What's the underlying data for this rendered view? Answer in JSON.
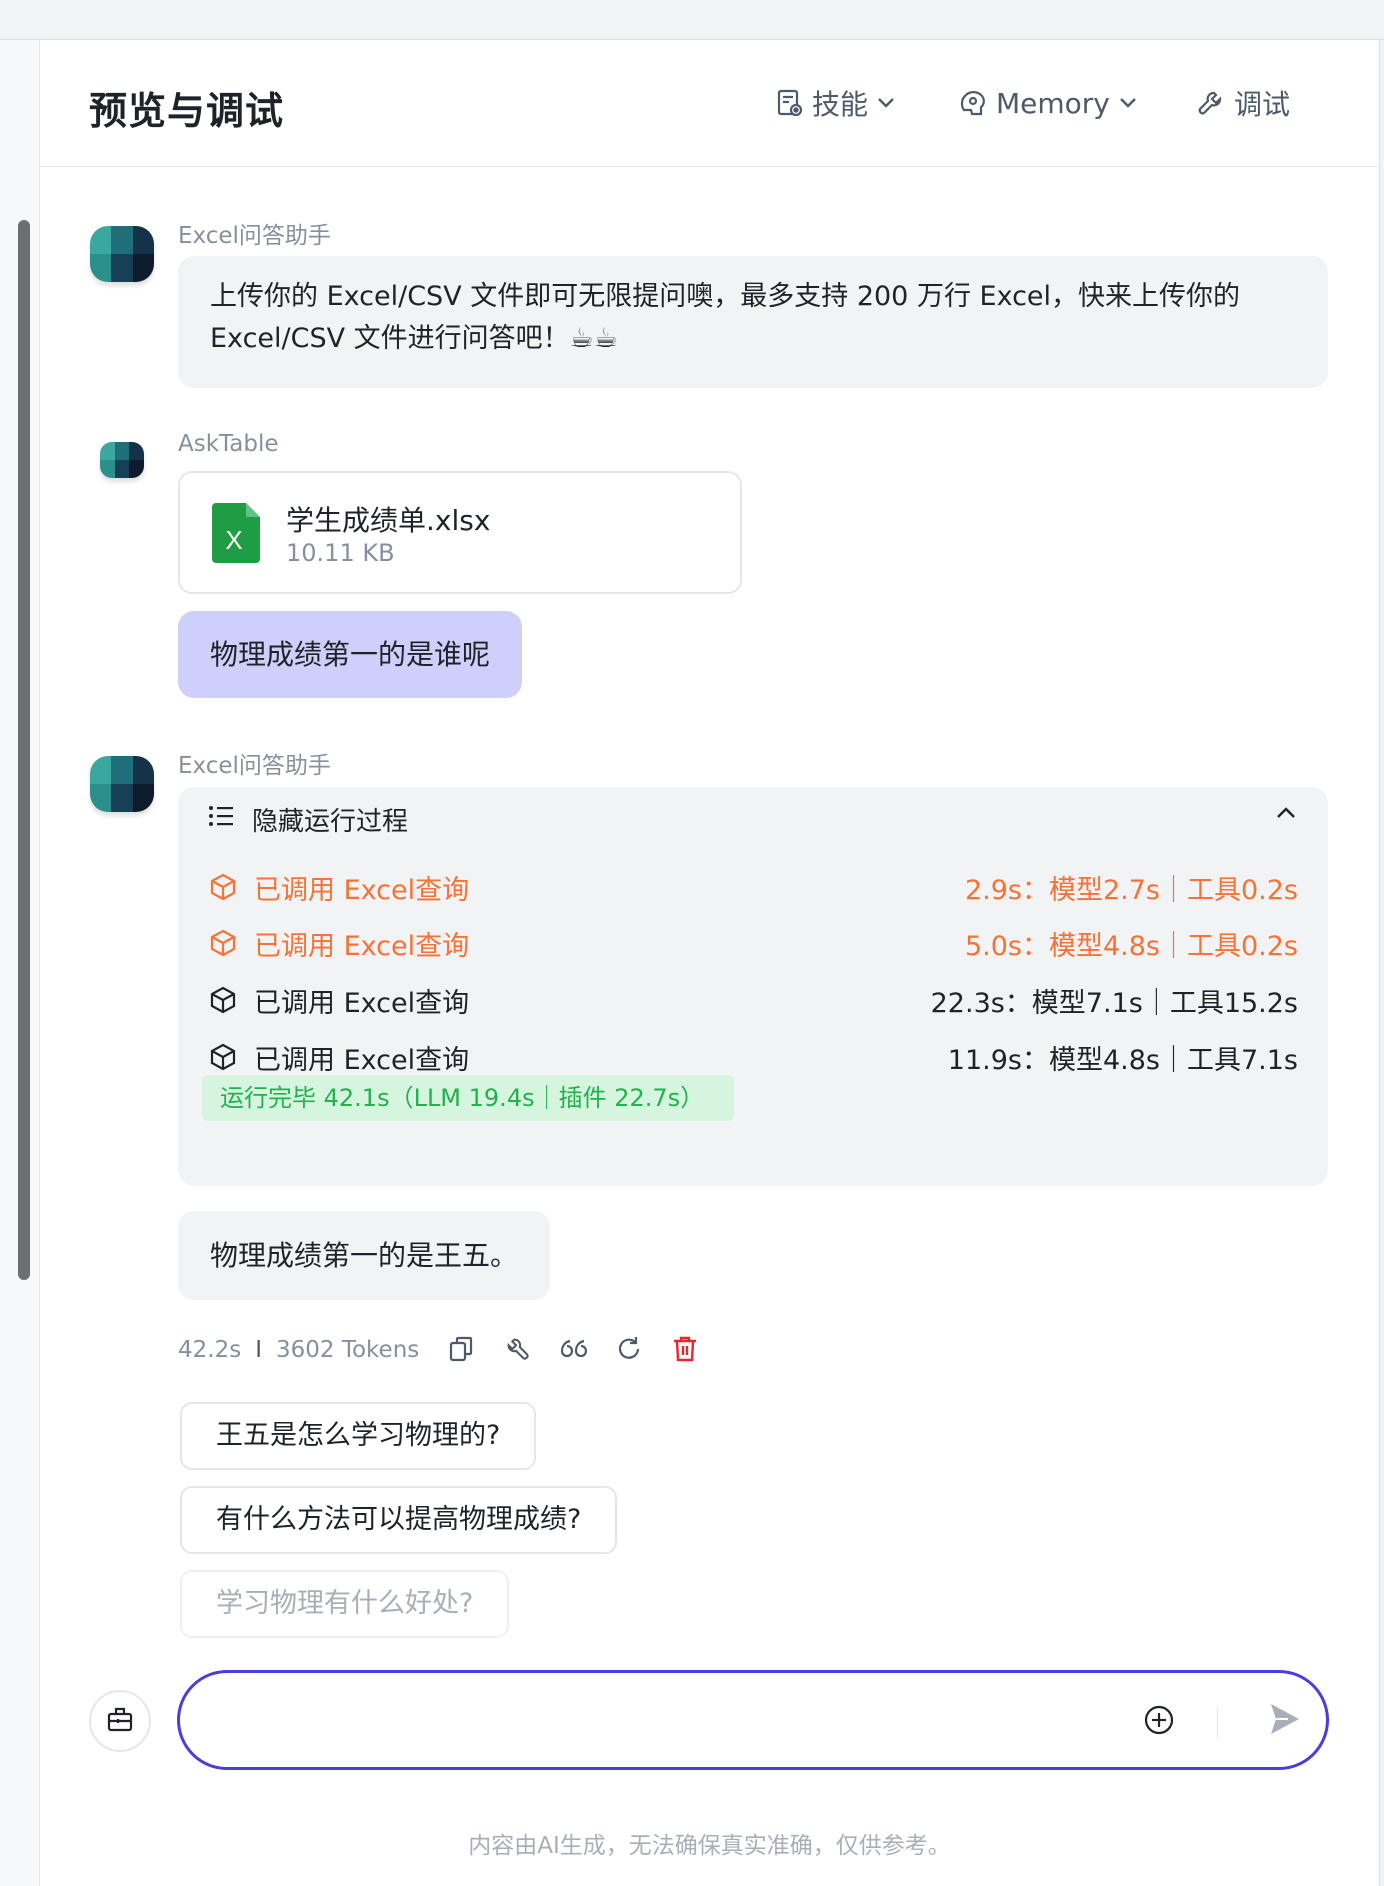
{
  "header": {
    "title": "预览与调试",
    "skills_label": "技能",
    "memory_label": "Memory",
    "debug_label": "调试"
  },
  "messages": {
    "bot1": {
      "sender": "Excel问答助手",
      "text_line1": "上传你的 Excel/CSV 文件即可无限提问噢，最多支持 200 万行 Excel，快来上传你的",
      "text_line2": "Excel/CSV 文件进行问答吧！☕☕"
    },
    "user": {
      "sender": "AskTable",
      "file_name": "学生成绩单.xlsx",
      "file_size": "10.11 KB",
      "file_icon_letter": "X",
      "question": "物理成绩第一的是谁呢"
    },
    "bot2": {
      "sender": "Excel问答助手",
      "process_toggle": "隐藏运行过程",
      "steps": [
        {
          "label": "已调用 Excel查询",
          "time": "2.9s：模型2.7s｜工具0.2s",
          "status": "orange"
        },
        {
          "label": "已调用 Excel查询",
          "time": "5.0s：模型4.8s｜工具0.2s",
          "status": "orange"
        },
        {
          "label": "已调用 Excel查询",
          "time": "22.3s：模型7.1s｜工具15.2s",
          "status": "dark"
        },
        {
          "label": "已调用 Excel查询",
          "time": "11.9s：模型4.8s｜工具7.1s",
          "status": "dark"
        }
      ],
      "done_text": "运行完毕 42.1s（LLM 19.4s｜插件 22.7s）",
      "answer": "物理成绩第一的是王五。",
      "duration": "42.2s",
      "meta_sep": "I",
      "tokens": "3602 Tokens"
    }
  },
  "suggestions": [
    "王五是怎么学习物理的?",
    "有什么方法可以提高物理成绩?",
    "学习物理有什么好处?"
  ],
  "input": {
    "value": "",
    "placeholder": ""
  },
  "disclaimer": "内容由AI生成，无法确保真实准确，仅供参考。",
  "colors": {
    "accent": "#4b3ddb",
    "user_bubble": "#cfcffc",
    "running_orange": "#f77234",
    "done_green": "#22b14c",
    "delete_red": "#e8262f",
    "excel_green": "#1f9d45"
  },
  "icons": [
    "skills-icon",
    "memory-icon",
    "wrench-icon",
    "list-icon",
    "chevron-up-icon",
    "cube-icon",
    "copy-icon",
    "quote-icon",
    "refresh-icon",
    "trash-icon",
    "toolbox-icon",
    "plus-circle-icon",
    "send-icon",
    "excel-file-icon"
  ]
}
